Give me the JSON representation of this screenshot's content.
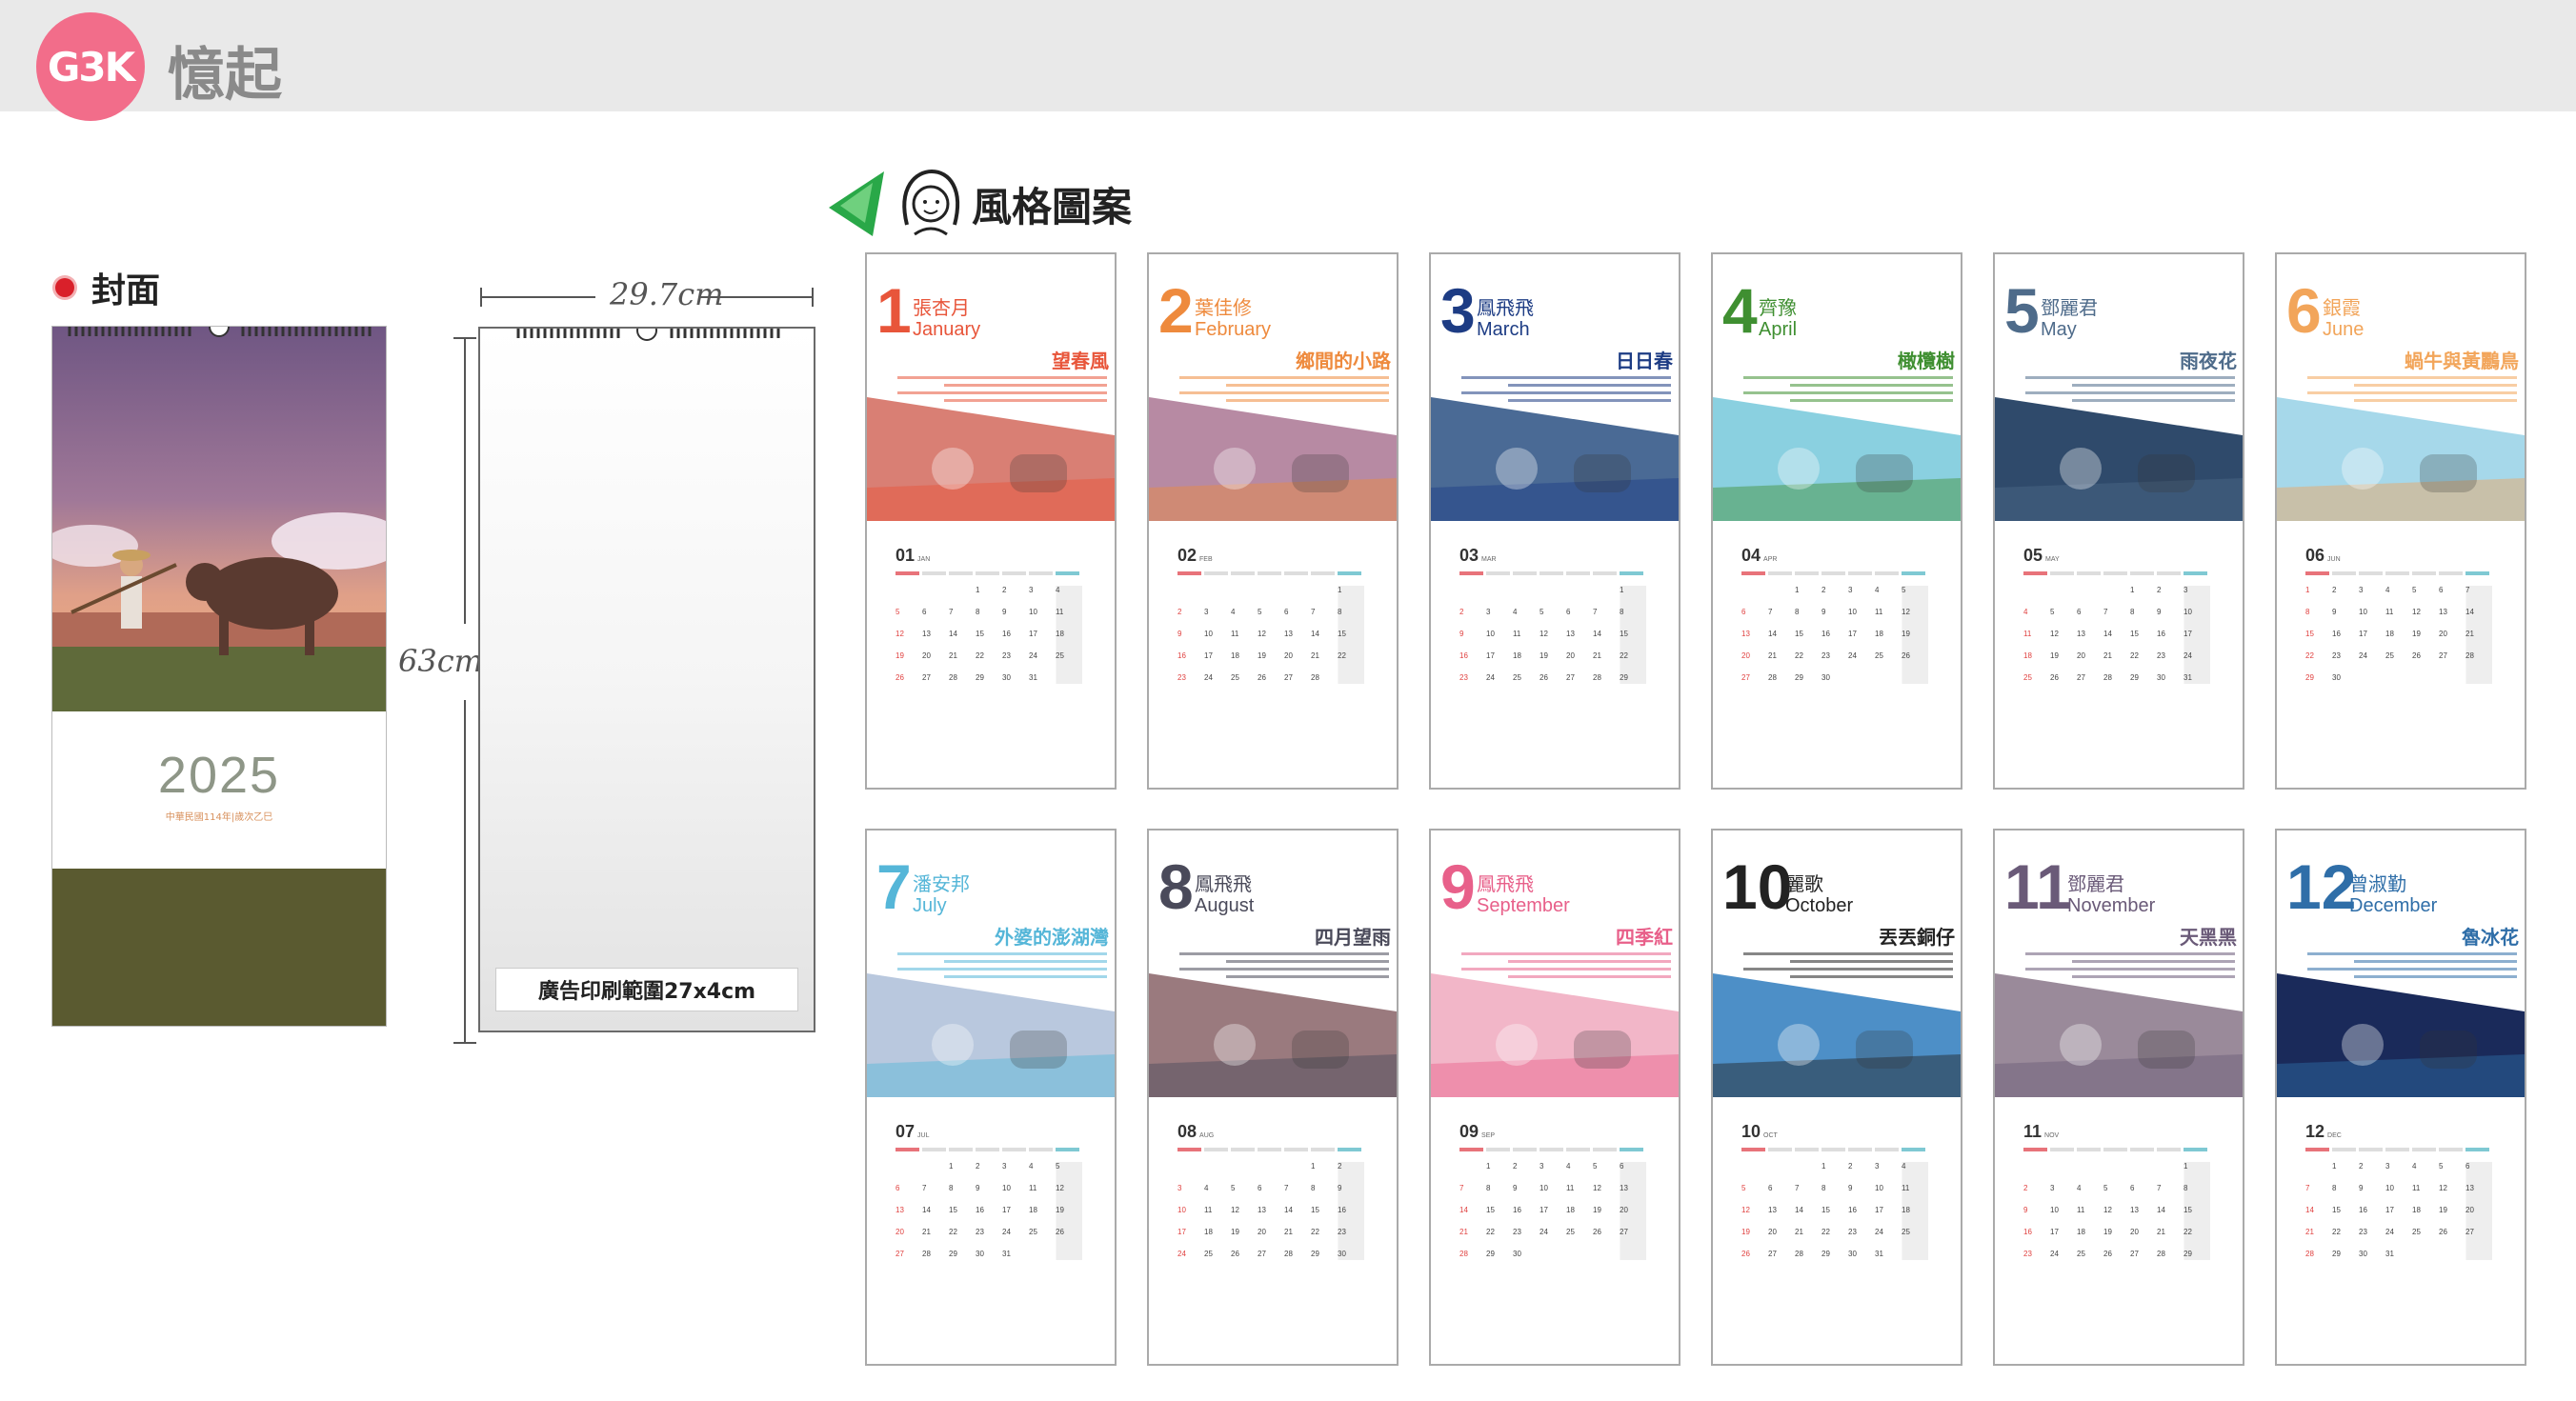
{
  "header": {
    "logo_text": "G3K",
    "brand": "憶起"
  },
  "cover_section": {
    "label": "封面",
    "year": "2025",
    "subtitle": "中華民國114年|歲次乙巳"
  },
  "blank_calendar": {
    "width_label": "29.7cm",
    "height_label": "63cm",
    "ad_area": "廣告印刷範圍27x4cm"
  },
  "style_section": {
    "title": "風格圖案"
  },
  "colors": {
    "header_bg": "#e9e9e9",
    "logo_pink": "#f26d8a",
    "cover_purple": "#7d5f88",
    "cover_olive": "#5a5a30"
  },
  "months": [
    {
      "num": "1",
      "author": "張杏月",
      "en": "January",
      "poem": "望春風",
      "mm": "01",
      "ab": "JAN",
      "color": "#e8553a",
      "sky": "#d97f74"
    },
    {
      "num": "2",
      "author": "葉佳修",
      "en": "February",
      "poem": "鄉間的小路",
      "mm": "02",
      "ab": "FEB",
      "color": "#ee8a3d",
      "sky": "#b78aa3"
    },
    {
      "num": "3",
      "author": "鳳飛飛",
      "en": "March",
      "poem": "日日春",
      "mm": "03",
      "ab": "MAR",
      "color": "#1d3c84",
      "sky": "#4a6a95"
    },
    {
      "num": "4",
      "author": "齊豫",
      "en": "April",
      "poem": "橄欖樹",
      "mm": "04",
      "ab": "APR",
      "color": "#3f8f31",
      "sky": "#8ad0e0"
    },
    {
      "num": "5",
      "author": "鄧麗君",
      "en": "May",
      "poem": "雨夜花",
      "mm": "05",
      "ab": "MAY",
      "color": "#4e6b8a",
      "sky": "#2f4a6b"
    },
    {
      "num": "6",
      "author": "銀霞",
      "en": "June",
      "poem": "蝸牛與黃鸝鳥",
      "mm": "06",
      "ab": "JUN",
      "color": "#f2a55a",
      "sky": "#a6d8ea"
    },
    {
      "num": "7",
      "author": "潘安邦",
      "en": "July",
      "poem": "外婆的澎湖灣",
      "mm": "07",
      "ab": "JUL",
      "color": "#55b6d8",
      "sky": "#b9c8de"
    },
    {
      "num": "8",
      "author": "鳳飛飛",
      "en": "August",
      "poem": "四月望雨",
      "mm": "08",
      "ab": "AUG",
      "color": "#4a4a5a",
      "sky": "#9a7a7e"
    },
    {
      "num": "9",
      "author": "鳳飛飛",
      "en": "September",
      "poem": "四季紅",
      "mm": "09",
      "ab": "SEP",
      "color": "#e8608a",
      "sky": "#f2b6c8"
    },
    {
      "num": "10",
      "author": "麗歌",
      "en": "October",
      "poem": "丟丟銅仔",
      "mm": "10",
      "ab": "OCT",
      "color": "#222222",
      "sky": "#4d8fc7"
    },
    {
      "num": "11",
      "author": "鄧麗君",
      "en": "November",
      "poem": "天黑黑",
      "mm": "11",
      "ab": "NOV",
      "color": "#6a5a78",
      "sky": "#9a8a9a"
    },
    {
      "num": "12",
      "author": "曾淑勤",
      "en": "December",
      "poem": "魯冰花",
      "mm": "12",
      "ab": "DEC",
      "color": "#2f6ea8",
      "sky": "#1a2a5a"
    }
  ]
}
